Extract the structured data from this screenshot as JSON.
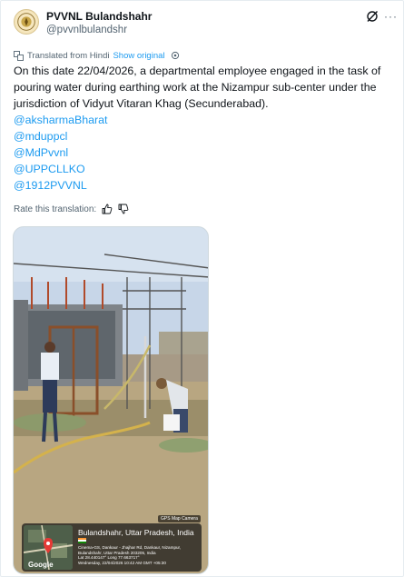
{
  "author": {
    "display_name": "PVVNL Bulandshahr",
    "handle": "@pvvnlbulandshr",
    "avatar_icon": "pvvnl-logo-avatar"
  },
  "header_icons": {
    "grok": "grok-slash-icon",
    "more": "more-options-icon"
  },
  "translation": {
    "label": "Translated from Hindi",
    "show_original": "Show original",
    "settings_icon": "gear-icon"
  },
  "tweet": {
    "text": "On this date 22/04/2026, a departmental employee engaged in the task of pouring water during earthing work at the Nizampur sub-center under the jurisdiction of Vidyut Vitaran Khag (Secunderabad).",
    "mentions": [
      "@aksharmaBharat",
      "@mduppcl",
      "@MdPvvnl",
      "@UPPCLLKO",
      "@1912PVVNL"
    ]
  },
  "rating": {
    "label": "Rate this translation:",
    "up_icon": "thumbs-up-icon",
    "down_icon": "thumbs-down-icon"
  },
  "media": {
    "gps_app": "GPS Map Camera",
    "location": "Bulandshahr, Uttar Pradesh, India",
    "address_line1": "Cinema-GS, Dankaur - Jhajhar Rd, Dankaur, Nizampur,",
    "address_line2": "Bulandshahr, Uttar Pradesh 203205, India",
    "coords": "Lat 28.440147° Long 77.663717°",
    "datetime": "Wednesday, 22/04/2026 10:42 AM GMT +05:30",
    "map_brand": "Google"
  },
  "colors": {
    "accent": "#1d9bf0",
    "text": "#0f1419",
    "secondary": "#536471",
    "flag_saffron": "#ff9933",
    "flag_white": "#ffffff",
    "flag_green": "#138808"
  }
}
